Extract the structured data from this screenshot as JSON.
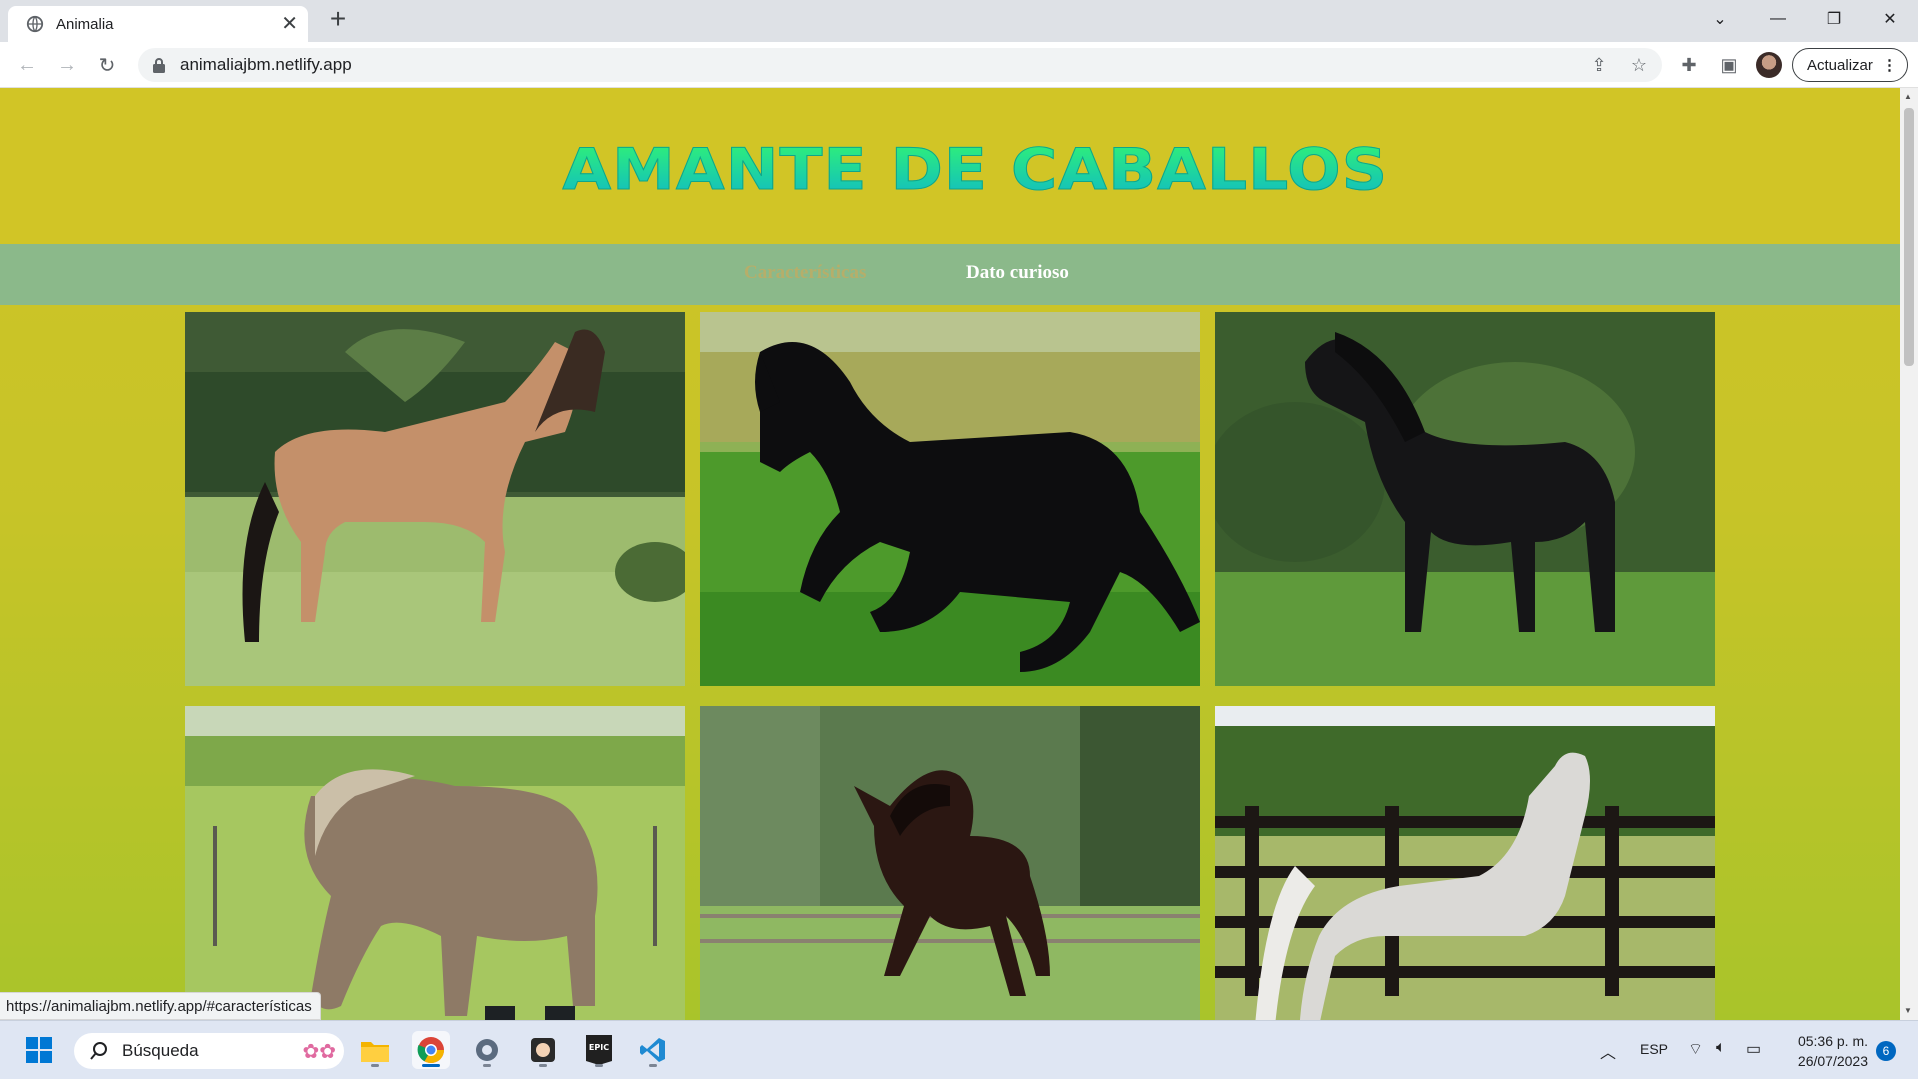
{
  "browser": {
    "tab_title": "Animalia",
    "url": "animaliajbm.netlify.app",
    "update_label": "Actualizar",
    "status_url": "https://animaliajbm.netlify.app/#características"
  },
  "site": {
    "title": "AMANTE DE CABALLOS",
    "nav": [
      {
        "label": "Características"
      },
      {
        "label": "Dato curioso"
      }
    ]
  },
  "photos": [
    {
      "name": "buckskin-horse-photo",
      "subject": "buckskin horse"
    },
    {
      "name": "black-galloping-horse-photo",
      "subject": "black horse galloping"
    },
    {
      "name": "black-friesian-horse-photo",
      "subject": "black horse standing"
    },
    {
      "name": "grazing-draft-horse-photo",
      "subject": "grey draft horse grazing"
    },
    {
      "name": "bay-running-horse-photo",
      "subject": "bay horse running"
    },
    {
      "name": "white-arabian-horse-photo",
      "subject": "white horse by fence"
    }
  ],
  "taskbar": {
    "search_placeholder": "Búsqueda",
    "language": "ESP",
    "time": "05:36 p. m.",
    "date": "26/07/2023",
    "notifications": "6"
  },
  "colors": {
    "header_bg": "#d1c526",
    "nav_bg": "#8bb98a",
    "title_gradient_top": "#33f570",
    "title_gradient_bottom": "#12b8c8"
  }
}
